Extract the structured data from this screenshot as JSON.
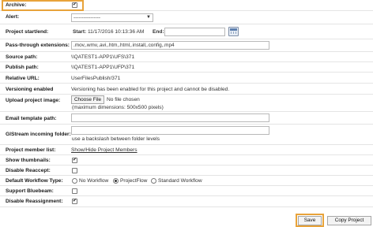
{
  "archive": {
    "label": "Archive:",
    "checked": true
  },
  "alert": {
    "label": "Alert:",
    "selected": "----------------"
  },
  "project_dates": {
    "label": "Project start/end:",
    "start_label": "Start:",
    "start_value": "11/17/2016 10:13:36 AM",
    "end_label": "End:",
    "end_value": "",
    "calendar_icon": "calendar-icon"
  },
  "passthrough": {
    "label": "Pass-through extensions:",
    "value": ".mov,.wmv,.avi,.htm,.html,.install,.config,.mp4"
  },
  "source_path": {
    "label": "Source path:",
    "value": "\\\\QATEST1-APP1\\UFS\\371"
  },
  "publish_path": {
    "label": "Publish path:",
    "value": "\\\\QATEST1-APP1\\UFP\\371"
  },
  "relative_url": {
    "label": "Relative URL:",
    "value": "UserFilesPublish/371"
  },
  "versioning": {
    "label": "Versioning enabled",
    "value": "Versioning has been enabled for this project and cannot be disabled."
  },
  "upload_image": {
    "label": "Upload project image:",
    "button": "Choose File",
    "status": "No file chosen",
    "note": "(maximum dimensions: 500x500 pixels)"
  },
  "email_template": {
    "label": "Email template path:",
    "value": ""
  },
  "glstream": {
    "label": "GlStream incoming folder:",
    "value": "",
    "hint": "use a backslash between folder levels"
  },
  "member_list": {
    "label": "Project member list:",
    "link": "Show/Hide Project Members"
  },
  "show_thumbnails": {
    "label": "Show thumbnails:",
    "checked": true
  },
  "disable_reaccept": {
    "label": "Disable Reaccept:",
    "checked": false
  },
  "workflow": {
    "label": "Default Workflow Type:",
    "options": [
      "No Workflow",
      "ProjectFlow",
      "Standard Workflow"
    ],
    "selected": "ProjectFlow"
  },
  "bluebeam": {
    "label": "Support Bluebeam:",
    "checked": false
  },
  "disable_reassign": {
    "label": "Disable Reassignment:",
    "checked": true
  },
  "actions": {
    "save": "Save",
    "copy": "Copy Project"
  },
  "colors": {
    "highlight": "#e8a33a",
    "link": "#1e5fa8"
  },
  "check_glyph": "✔"
}
